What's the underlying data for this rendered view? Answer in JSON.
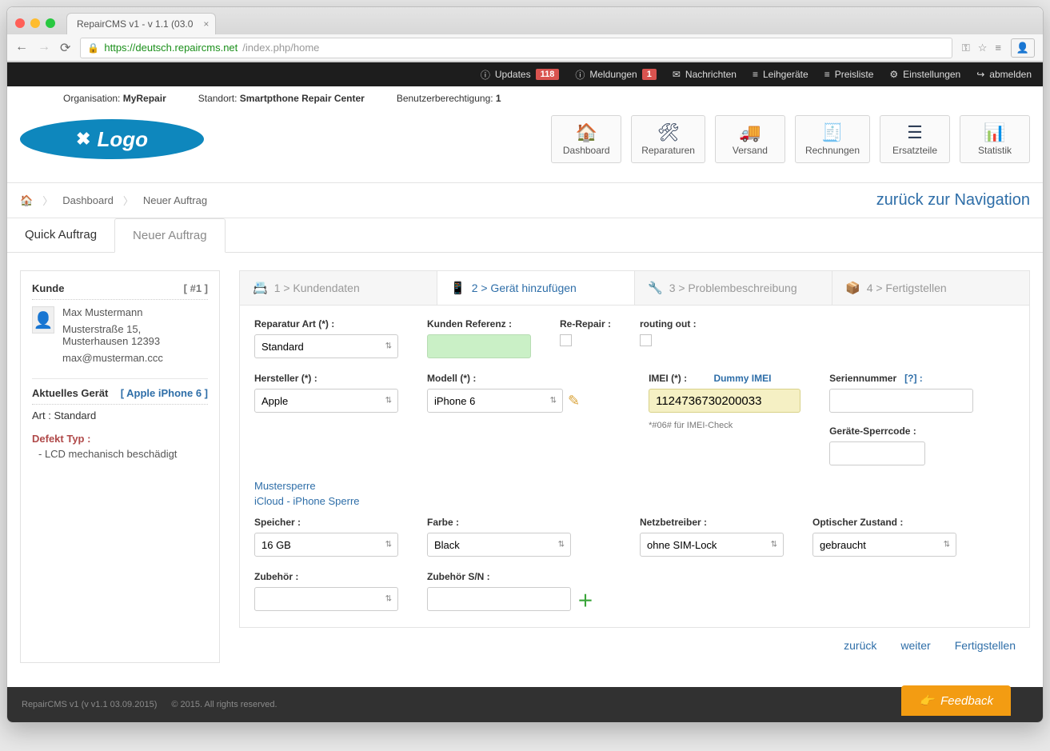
{
  "browser": {
    "tab_title": "RepairCMS v1 - v 1.1 (03.0",
    "url_host": "https://deutsch.repaircms.net",
    "url_path": "/index.php/home"
  },
  "topbar": {
    "updates": {
      "label": "Updates",
      "badge": "118"
    },
    "meldungen": {
      "label": "Meldungen",
      "badge": "1"
    },
    "nachrichten": "Nachrichten",
    "leihgeraete": "Leihgeräte",
    "preisliste": "Preisliste",
    "einstellungen": "Einstellungen",
    "abmelden": "abmelden"
  },
  "orgbar": {
    "org_label": "Organisation:",
    "org_value": "MyRepair",
    "standort_label": "Standort:",
    "standort_value": "Smartpthone Repair Center",
    "perm_label": "Benutzerberechtigung:",
    "perm_value": "1"
  },
  "logo_text": "Logo",
  "main_nav": {
    "dashboard": "Dashboard",
    "reparaturen": "Reparaturen",
    "versand": "Versand",
    "rechnungen": "Rechnungen",
    "ersatzteile": "Ersatzteile",
    "statistik": "Statistik"
  },
  "breadcrumb": {
    "home_icon": "⌂",
    "dashboard": "Dashboard",
    "current": "Neuer Auftrag",
    "back": "zurück zur Navigation"
  },
  "tabs": {
    "quick": "Quick Auftrag",
    "neuer": "Neuer Auftrag"
  },
  "sidebar": {
    "kunde_label": "Kunde",
    "kunde_num": "[ #1 ]",
    "name": "Max Mustermann",
    "address": "Musterstraße 15, Musterhausen 12393",
    "email": "max@musterman.ccc",
    "device_label": "Aktuelles Gerät",
    "device_value": "[ Apple iPhone 6 ]",
    "art": "Art : Standard",
    "defekt_label": "Defekt Typ :",
    "defekt_value": "- LCD mechanisch beschädigt"
  },
  "wizard": {
    "s1": "1 > Kundendaten",
    "s2": "2 > Gerät hinzufügen",
    "s3": "3 > Problembeschreibung",
    "s4": "4 > Fertigstellen"
  },
  "form": {
    "reparatur_art_label": "Reparatur Art (*) :",
    "reparatur_art_value": "Standard",
    "kunden_ref_label": "Kunden Referenz :",
    "kunden_ref_value": "",
    "re_repair_label": "Re-Repair :",
    "routing_out_label": "routing out :",
    "hersteller_label": "Hersteller (*) :",
    "hersteller_value": "Apple",
    "modell_label": "Modell (*) :",
    "modell_value": "iPhone 6",
    "imei_label": "IMEI (*) :",
    "dummy_imei": "Dummy IMEI",
    "imei_value": "1124736730200033",
    "imei_hint": "*#06# für IMEI-Check",
    "serien_label": "Seriennummer",
    "serien_help": "[?] :",
    "serien_value": "",
    "sperrcode_label": "Geräte-Sperrcode :",
    "sperrcode_value": "",
    "mustersperre": "Mustersperre",
    "icloud": "iCloud - iPhone Sperre",
    "speicher_label": "Speicher :",
    "speicher_value": "16 GB",
    "farbe_label": "Farbe :",
    "farbe_value": "Black",
    "netz_label": "Netzbetreiber :",
    "netz_value": "ohne SIM-Lock",
    "optisch_label": "Optischer Zustand :",
    "optisch_value": "gebraucht",
    "zubehoer_label": "Zubehör :",
    "zubehoer_value": "",
    "zubehoer_sn_label": "Zubehör S/N :",
    "zubehoer_sn_value": ""
  },
  "footer_btns": {
    "zurueck": "zurück",
    "weiter": "weiter",
    "fertig": "Fertigstellen"
  },
  "page_footer": {
    "version": "RepairCMS v1 (v v1.1 03.09.2015)",
    "copyright": "© 2015. All rights reserved.",
    "feedback": "Feedback"
  }
}
